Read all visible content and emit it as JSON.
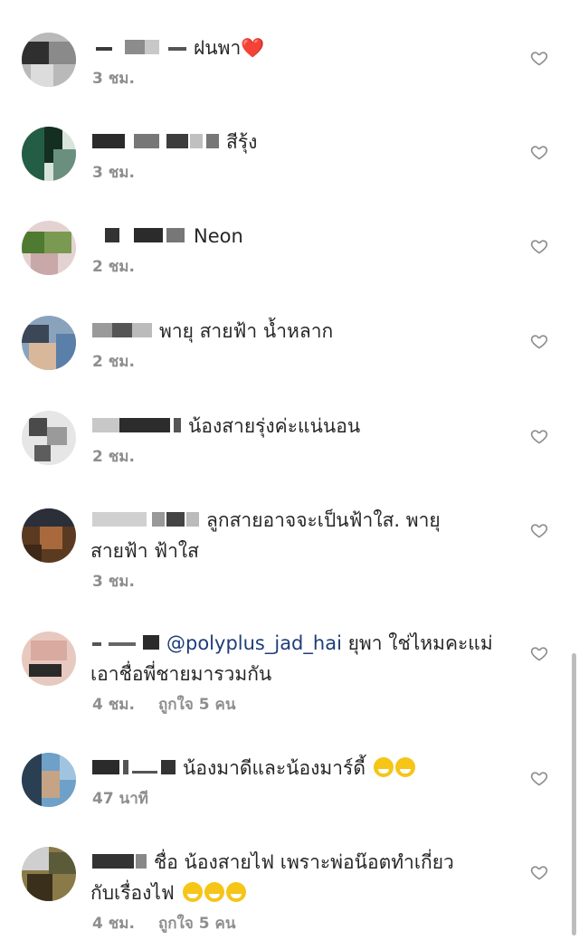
{
  "comments": [
    {
      "text": "ฝนพา❤️",
      "time": "3 ชม.",
      "likes": ""
    },
    {
      "text": "สีรุ้ง",
      "time": "3 ชม.",
      "likes": ""
    },
    {
      "text": "Neon",
      "time": "2 ชม.",
      "likes": ""
    },
    {
      "text": "พายุ สายฟ้า น้ำหลาก",
      "time": "2 ชม.",
      "likes": ""
    },
    {
      "text": "น้องสายรุ่งค่ะแน่นอน",
      "time": "2 ชม.",
      "likes": ""
    },
    {
      "text": "ลูกสายอาจจะเป็นฟ้าใส. พายุ",
      "text2": "สายฟ้า ฟ้าใส",
      "time": "3 ชม.",
      "likes": ""
    },
    {
      "mention": "@polyplus_jad_hai",
      "text": "ยุพา ใช่ไหมคะแม่",
      "text2": "เอาชื่อพี่ชายมารวมกัน",
      "time": "4 ชม.",
      "likes": "ถูกใจ 5 คน"
    },
    {
      "text": "น้องมาดีและน้องมาร์ดี้",
      "time": "47 นาที",
      "likes": ""
    },
    {
      "text": "ชื่อ น้องสายไฟ  เพราะพ่อน๊อตทำเกี่ยว",
      "text2": "กับเรื่องไฟ",
      "time": "4 ชม.",
      "likes": "ถูกใจ 5 คน"
    }
  ],
  "icons": {
    "like": "heart-outline-icon",
    "emoji": "grinning-face-icon"
  },
  "colors": {
    "text": "#262626",
    "meta": "#8e8e8e",
    "mention": "#1f3d7a",
    "heart": "#e0245e"
  }
}
